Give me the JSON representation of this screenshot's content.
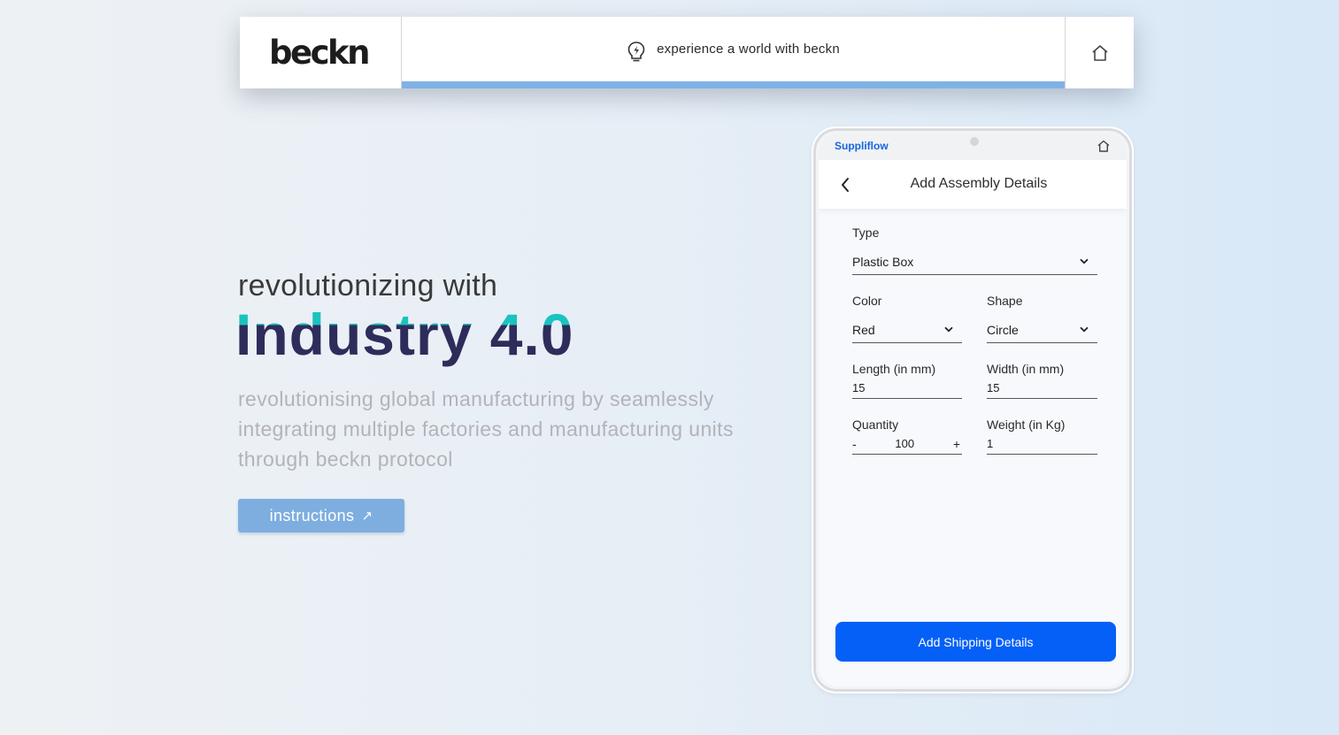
{
  "header": {
    "logo_text": "beckn",
    "tagline": "experience a world with beckn",
    "progress_percent": 100,
    "bulb_icon": "lightbulb-bolt-icon",
    "home_icon": "home-icon"
  },
  "hero": {
    "line1": "revolutionizing with",
    "line2": "Industry 4.0",
    "description": "revolutionising global manufacturing by seamlessly integrating multiple factories and manufacturing units through beckn protocol",
    "instructions_label": "instructions",
    "instructions_icon": "↗"
  },
  "phone": {
    "brand": "Suppliflow",
    "status_home_icon": "home-icon",
    "title": "Add Assembly Details",
    "back_icon": "chevron-left-icon",
    "fields": {
      "type": {
        "label": "Type",
        "value": "Plastic Box"
      },
      "color": {
        "label": "Color",
        "value": "Red"
      },
      "shape": {
        "label": "Shape",
        "value": "Circle"
      },
      "length": {
        "label": "Length (in mm)",
        "value": "15"
      },
      "width": {
        "label": "Width (in mm)",
        "value": "15"
      },
      "quantity": {
        "label": "Quantity",
        "value": "100",
        "decrement": "-",
        "increment": "+"
      },
      "weight": {
        "label": "Weight (in Kg)",
        "value": "1"
      }
    },
    "submit_label": "Add Shipping Details"
  },
  "colors": {
    "accent_blue": "#0560f8",
    "progress_blue": "#7eb2e6",
    "teal": "#19c3c0",
    "navy": "#2e2c5a",
    "brand_blue": "#1565e0"
  }
}
